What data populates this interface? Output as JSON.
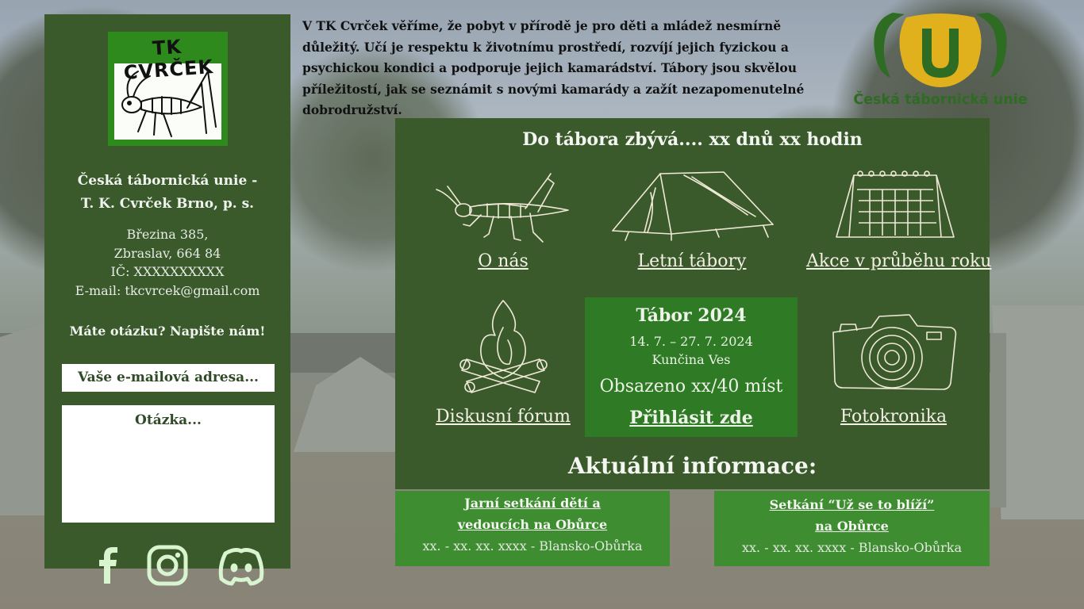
{
  "sidebar": {
    "logo_text": "TK CVRČEK",
    "org_name_line1": "Česká tábornická unie -",
    "org_name_line2": "T. K. Cvrček Brno, p. s.",
    "address": [
      "Březina 385,",
      "Zbraslav, 664 84",
      "IČ: XXXXXXXXXX",
      "E-mail: tkcvrcek@gmail.com"
    ],
    "question_cta": "Máte otázku? Napište nám!",
    "email_placeholder": "Vaše e-mailová adresa...",
    "question_placeholder": "Otázka...",
    "socials": [
      "facebook-icon",
      "instagram-icon",
      "discord-icon"
    ]
  },
  "intro_text": "V TK Cvrček věříme, že pobyt v přírodě je pro děti a mládež nesmírně důležitý. Učí je respektu k životnímu prostředí, rozvíjí jejich fyzickou a psychickou kondici a podporuje jejich kamarádství. Tábory jsou skvělou příležitostí, jak se seznámit s novými kamarády a zažít nezapomenutelné dobrodružství.",
  "union": {
    "name": "Česká tábornická unie"
  },
  "panel": {
    "countdown": "Do tábora zbývá.... xx dnů xx hodin",
    "nav": {
      "about": "O nás",
      "summer_camps": "Letní tábory",
      "year_events": "Akce v průběhu roku",
      "forum": "Diskusní fórum",
      "photo_chronicle": "Fotokronika"
    },
    "camp": {
      "title": "Tábor 2024",
      "dates": "14. 7. – 27. 7. 2024",
      "place": "Kunčina Ves",
      "capacity": "Obsazeno xx/40 míst",
      "signup": "Přihlásit zde"
    },
    "news_title": "Aktuální informace:"
  },
  "news": [
    {
      "title_line1": "Jarní setkání dětí a",
      "title_line2": "vedoucích na Obůrce",
      "sub": "xx. - xx. xx. xxxx - Blansko-Obůrka"
    },
    {
      "title_line1": "Setkání “Už se to blíží”",
      "title_line2": "na Obůrce",
      "sub": "xx. - xx. xx. xxxx - Blansko-Obůrka"
    }
  ],
  "colors": {
    "panel": "#3a5a2c",
    "camp_box": "#2f7a24",
    "news_card": "#3e8d30",
    "union_green": "#2e6b23",
    "union_gold": "#e0b11c"
  }
}
